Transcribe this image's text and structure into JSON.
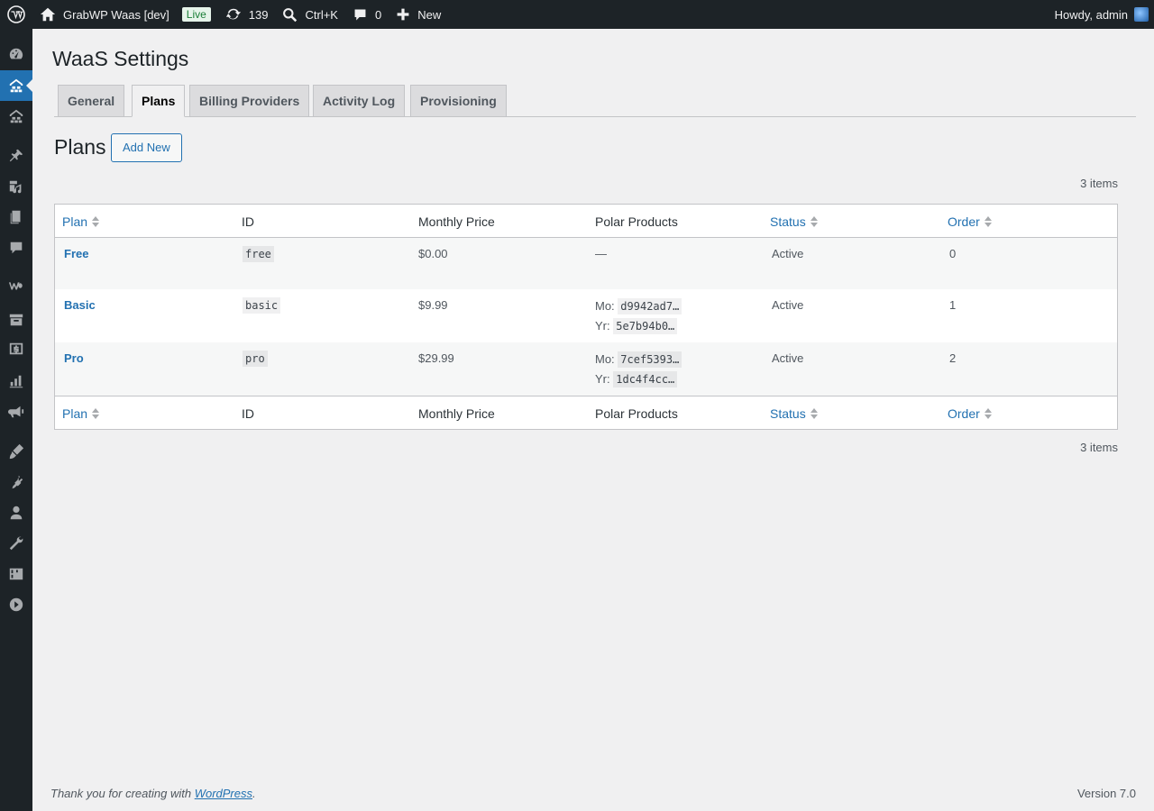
{
  "adminbar": {
    "site_name": "GrabWP Waas [dev]",
    "live_badge": "Live",
    "updates_count": "139",
    "search_shortcut": "Ctrl+K",
    "comments_count": "0",
    "new_label": "New",
    "greeting": "Howdy, admin"
  },
  "sidebar": {
    "icons": [
      "dashboard-icon",
      "waas-icon",
      "sites-icon",
      "posts-icon",
      "media-icon",
      "pages-icon",
      "comments-icon",
      "woocommerce-icon",
      "products-icon",
      "payments-icon",
      "analytics-icon",
      "marketing-icon",
      "appearance-icon",
      "plugins-icon",
      "users-icon",
      "tools-icon",
      "settings-icon",
      "collapse-icon"
    ],
    "current": "waas-icon"
  },
  "page": {
    "title": "WaaS Settings",
    "tabs": [
      "General",
      "Plans",
      "Billing Providers",
      "Activity Log",
      "Provisioning"
    ],
    "active_tab": "Plans",
    "section_title": "Plans",
    "add_new_label": "Add New",
    "items_count": "3 items"
  },
  "table": {
    "columns": [
      "Plan",
      "ID",
      "Monthly Price",
      "Polar Products",
      "Status",
      "Order"
    ],
    "rows": [
      {
        "plan": "Free",
        "id": "free",
        "price": "$0.00",
        "products_none": "—",
        "status": "Active",
        "order": "0"
      },
      {
        "plan": "Basic",
        "id": "basic",
        "price": "$9.99",
        "mo_label": "Mo:",
        "mo": "d9942ad7…",
        "yr_label": "Yr:",
        "yr": "5e7b94b0…",
        "status": "Active",
        "order": "1"
      },
      {
        "plan": "Pro",
        "id": "pro",
        "price": "$29.99",
        "mo_label": "Mo:",
        "mo": "7cef5393…",
        "yr_label": "Yr:",
        "yr": "1dc4f4cc…",
        "status": "Active",
        "order": "2"
      }
    ]
  },
  "footer": {
    "thanks_prefix": "Thank you for creating with ",
    "thanks_link": "WordPress",
    "thanks_suffix": ".",
    "version": "Version 7.0"
  },
  "colors": {
    "adminbar_bg": "#1d2327",
    "link": "#2271b1",
    "page_bg": "#f0f0f1",
    "live_badge_bg": "#e6f4ea",
    "live_badge_text": "#1a7f37"
  }
}
